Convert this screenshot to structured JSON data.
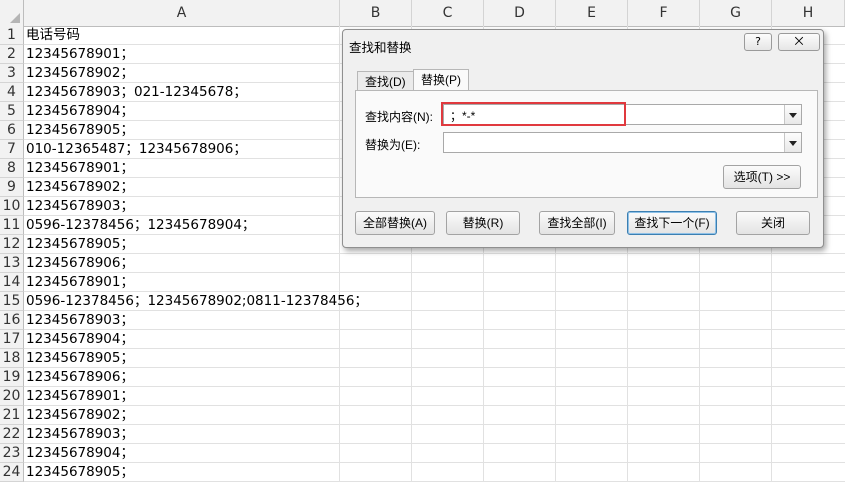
{
  "sheet": {
    "columns": [
      "A",
      "B",
      "C",
      "D",
      "E",
      "F",
      "G",
      "H"
    ],
    "rows": [
      {
        "n": "1",
        "a": "电话号码"
      },
      {
        "n": "2",
        "a": "12345678901；"
      },
      {
        "n": "3",
        "a": "12345678902；"
      },
      {
        "n": "4",
        "a": "12345678903；021-12345678；"
      },
      {
        "n": "5",
        "a": "12345678904；"
      },
      {
        "n": "6",
        "a": "12345678905；"
      },
      {
        "n": "7",
        "a": "010-12365487；12345678906；"
      },
      {
        "n": "8",
        "a": "12345678901；"
      },
      {
        "n": "9",
        "a": "12345678902；"
      },
      {
        "n": "10",
        "a": "12345678903；"
      },
      {
        "n": "11",
        "a": "0596-12378456；12345678904；"
      },
      {
        "n": "12",
        "a": "12345678905；"
      },
      {
        "n": "13",
        "a": "12345678906；"
      },
      {
        "n": "14",
        "a": "12345678901；"
      },
      {
        "n": "15",
        "a": "0596-12378456；12345678902;0811-12378456；"
      },
      {
        "n": "16",
        "a": "12345678903；"
      },
      {
        "n": "17",
        "a": "12345678904；"
      },
      {
        "n": "18",
        "a": "12345678905；"
      },
      {
        "n": "19",
        "a": "12345678906；"
      },
      {
        "n": "20",
        "a": "12345678901；"
      },
      {
        "n": "21",
        "a": "12345678902；"
      },
      {
        "n": "22",
        "a": "12345678903；"
      },
      {
        "n": "23",
        "a": "12345678904；"
      },
      {
        "n": "24",
        "a": "12345678905；"
      }
    ]
  },
  "dialog": {
    "title": "查找和替换",
    "help_label": "?",
    "close_label": "⨉",
    "tabs": [
      {
        "label": "查找(D)"
      },
      {
        "label": "替换(P)"
      }
    ],
    "find_label": "查找内容(N):",
    "find_value": "；*-*",
    "replace_label": "替换为(E):",
    "replace_value": "",
    "options_button": "选项(T) >>",
    "buttons": {
      "replace_all": "全部替换(A)",
      "replace": "替换(R)",
      "find_all": "查找全部(I)",
      "find_next": "查找下一个(F)",
      "close": "关闭"
    }
  }
}
